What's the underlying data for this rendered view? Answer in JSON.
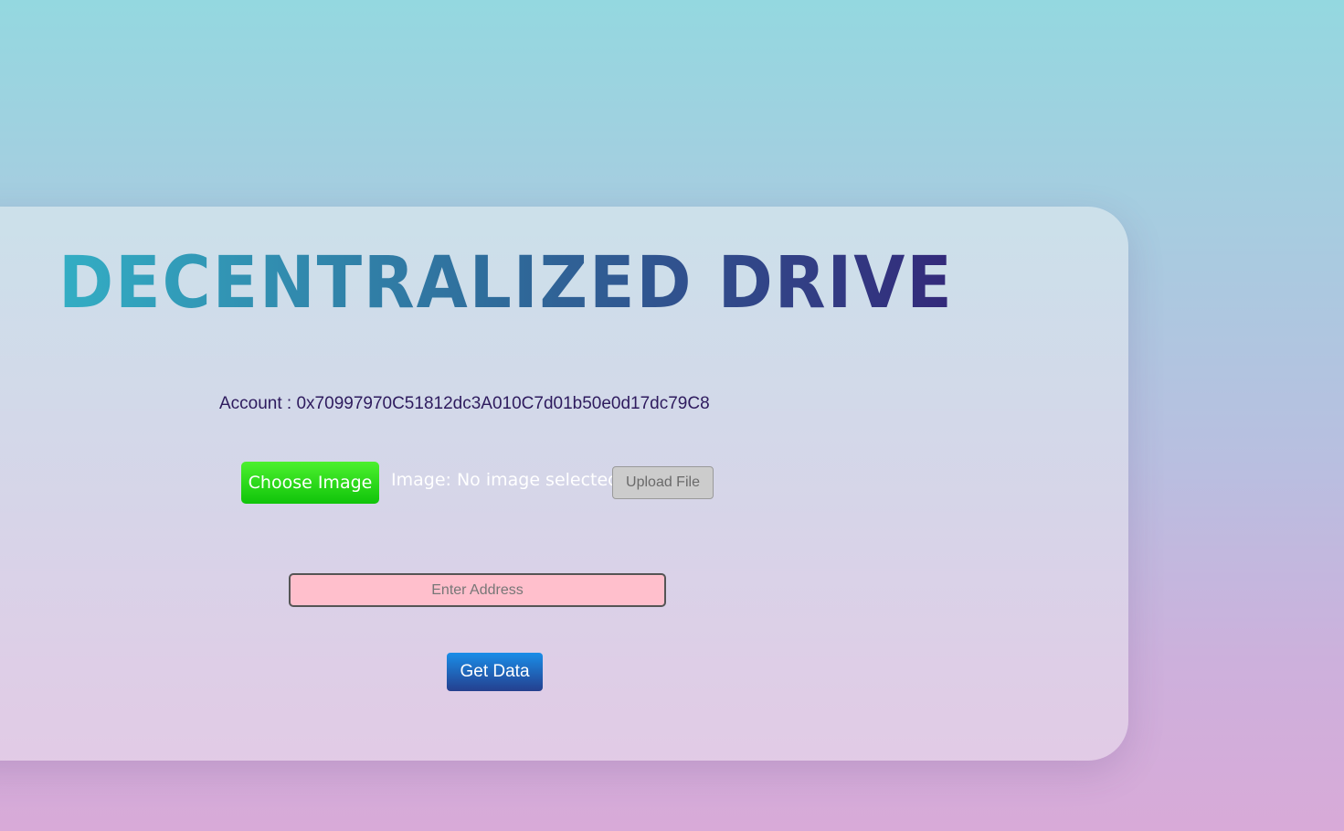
{
  "app": {
    "title": "DECENTRALIZED DRIVE"
  },
  "account": {
    "label": "Account : 0x70997970C51812dc3A010C7d01b50e0d17dc79C8"
  },
  "upload": {
    "choose_label": "Choose Image",
    "image_status": "Image: No image selected",
    "upload_label": "Upload File"
  },
  "fetch": {
    "address_placeholder": "Enter Address",
    "address_value": "",
    "get_data_label": "Get Data"
  },
  "colors": {
    "title_gradient_start": "#33aec4",
    "title_gradient_end": "#33297a",
    "choose_button": "#10c40a",
    "upload_button": "#cccccc",
    "address_input_bg": "#ffbfcc",
    "get_data_button": "#1a8ee8"
  }
}
